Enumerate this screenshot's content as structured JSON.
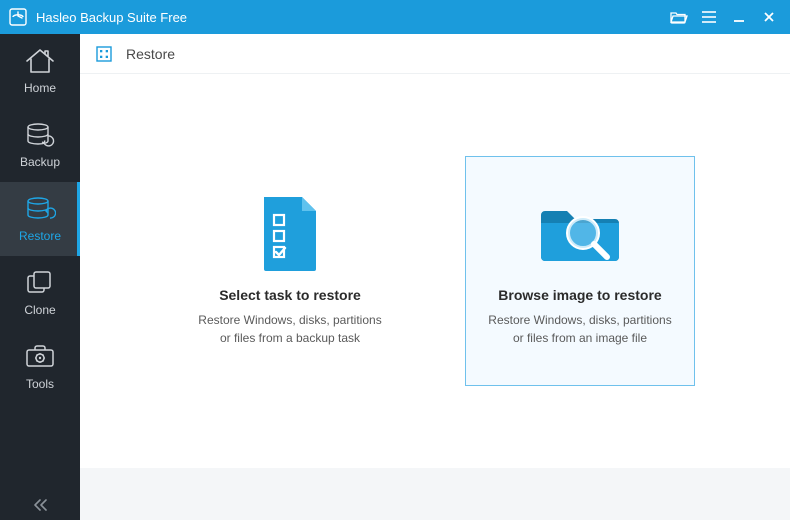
{
  "titlebar": {
    "app_title": "Hasleo Backup Suite Free"
  },
  "sidebar": {
    "items": [
      {
        "id": "home",
        "label": "Home"
      },
      {
        "id": "backup",
        "label": "Backup"
      },
      {
        "id": "restore",
        "label": "Restore"
      },
      {
        "id": "clone",
        "label": "Clone"
      },
      {
        "id": "tools",
        "label": "Tools"
      }
    ],
    "active_id": "restore"
  },
  "breadcrumb": {
    "label": "Restore"
  },
  "options": [
    {
      "id": "select-task",
      "title": "Select task to restore",
      "description": "Restore Windows, disks, partitions or files from a backup task",
      "selected": false
    },
    {
      "id": "browse-image",
      "title": "Browse image to restore",
      "description": "Restore Windows, disks, partitions or files from an image file",
      "selected": true
    }
  ],
  "colors": {
    "accent": "#1b9bdb",
    "sidebar_bg": "#20262d",
    "sidebar_active_bg": "#343c44"
  }
}
